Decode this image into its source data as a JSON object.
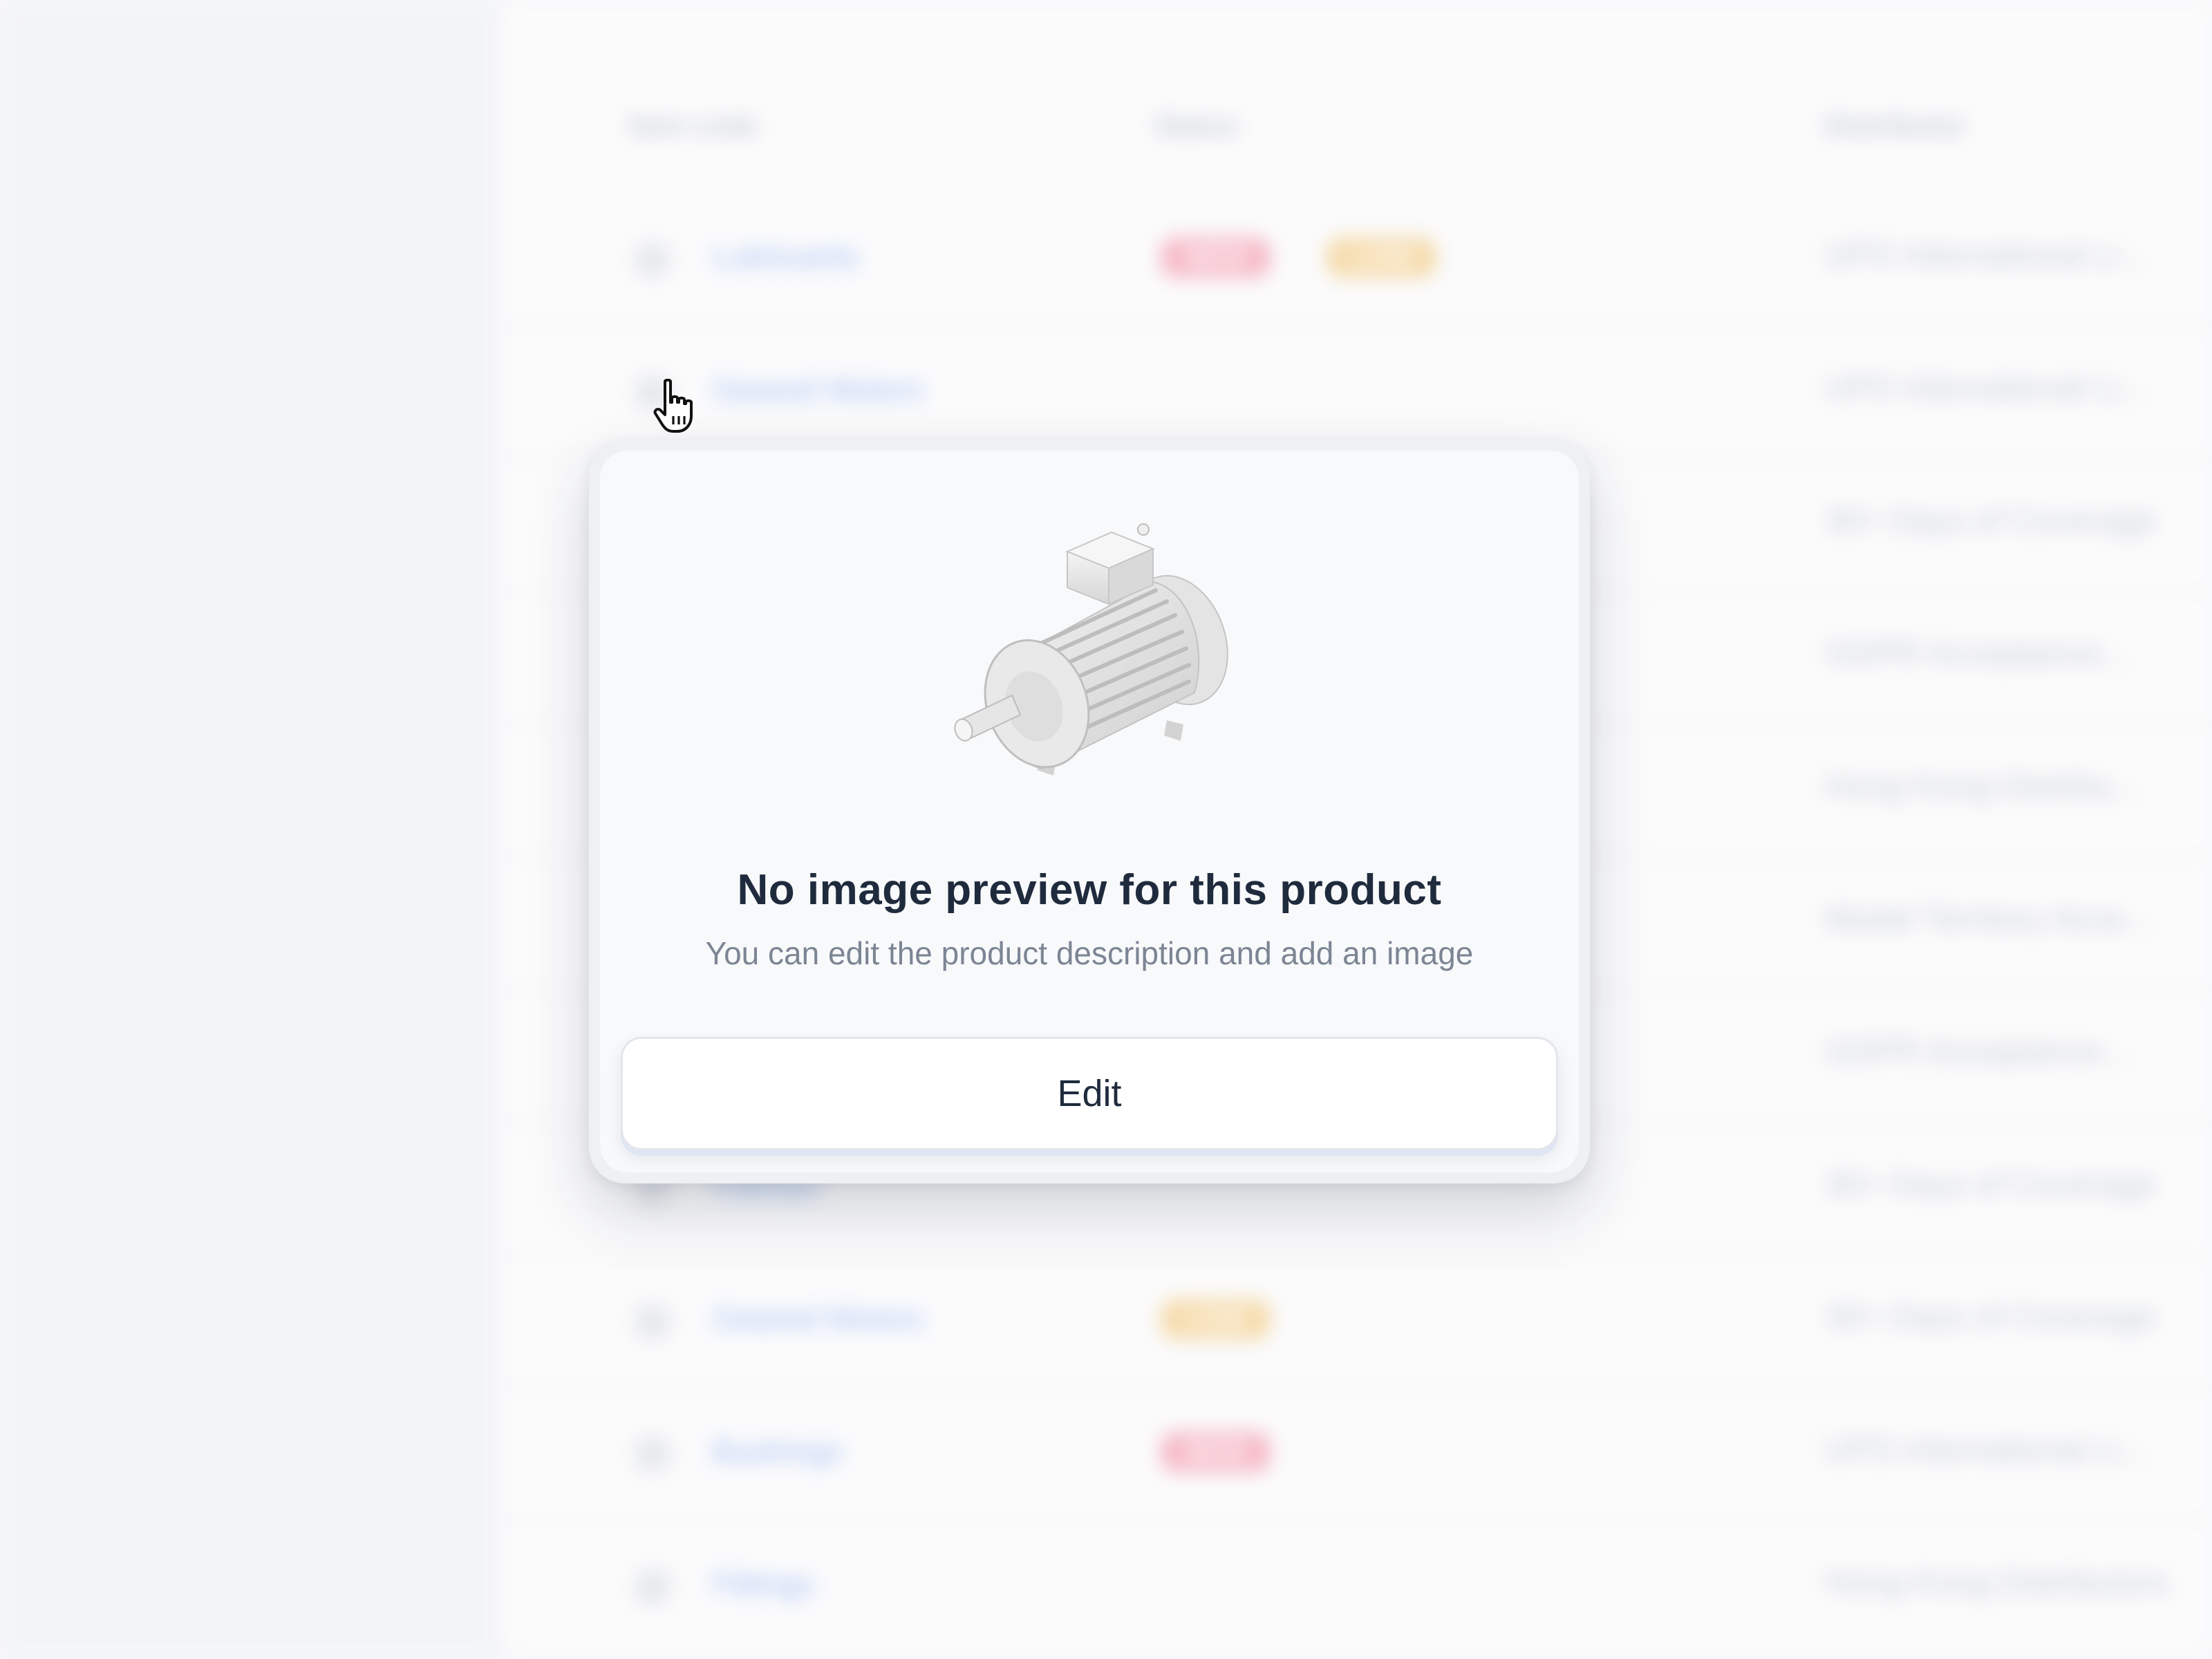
{
  "background_table": {
    "columns": [
      "Item code",
      "Status",
      "Distributor"
    ],
    "rows": [
      {
        "code": "Lubricants",
        "badges": [
          {
            "text": "NEW",
            "color": "#f6b6c4"
          },
          {
            "text": "LOW",
            "color": "#f5d9a6"
          }
        ],
        "distributor": "UPS International Li..."
      },
      {
        "code": "Geared Motors",
        "badges": [],
        "distributor": "UPS International Li..."
      },
      {
        "code": "",
        "badges": [],
        "distributor": "30+ Days of Coverage"
      },
      {
        "code": "",
        "badges": [],
        "distributor": "GDPR Acceptance..."
      },
      {
        "code": "",
        "badges": [],
        "distributor": "Hong Kong Distribu..."
      },
      {
        "code": "",
        "badges": [],
        "distributor": "Model Territory Acce..."
      },
      {
        "code": "",
        "badges": [],
        "distributor": "GDPR Acceptance..."
      },
      {
        "code": "Clamps",
        "badges": [],
        "distributor": "30+ Days of Coverage"
      },
      {
        "code": "Geared Motors",
        "badges": [
          {
            "text": "LOW",
            "color": "#f5d9a6"
          }
        ],
        "distributor": "30+ Days of Coverage"
      },
      {
        "code": "Bushings",
        "badges": [
          {
            "text": "NEW",
            "color": "#f6b6c4"
          }
        ],
        "distributor": "UPS International Li..."
      },
      {
        "code": "Fittings",
        "badges": [],
        "distributor": "Hong Kong Distributors"
      }
    ]
  },
  "popover": {
    "title": "No image preview for this product",
    "subtitle": "You can edit the product description and add an image",
    "edit_label": "Edit",
    "illustration": "electric-motor-icon"
  },
  "cursor": "hand-pointer-icon"
}
